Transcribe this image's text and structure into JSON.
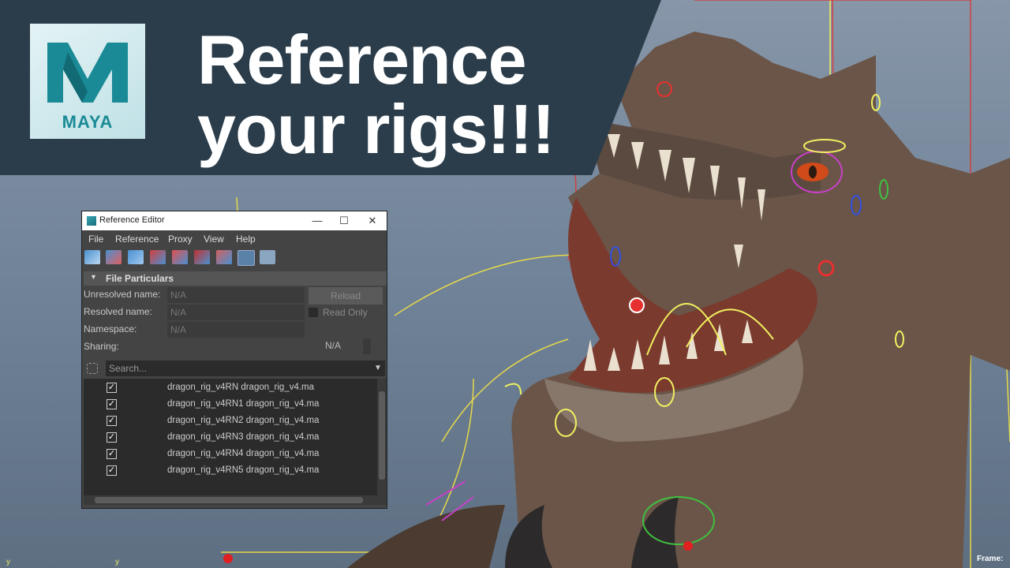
{
  "banner": {
    "logo_word": "MAYA",
    "headline_line1": "Reference",
    "headline_line2": "your rigs!!!",
    "colors": {
      "banner_bg": "#2b3d4a",
      "logo_accent": "#1a8a96"
    }
  },
  "window": {
    "title": "Reference Editor",
    "controls": {
      "minimize": "—",
      "maximize": "☐",
      "close": "✕"
    },
    "menus": [
      "File",
      "Reference",
      "Proxy",
      "View",
      "Help"
    ],
    "toolbar_icons": [
      "load-reference-icon",
      "unload-reference-icon",
      "reload-reference-icon",
      "remove-reference-icon",
      "import-objects-icon",
      "export-icon",
      "duplicate-reference-icon",
      "list-view-icon",
      "table-view-icon"
    ],
    "section_title": "File Particulars",
    "section_arrow": "▼",
    "fields": {
      "unresolved_label": "Unresolved name:",
      "unresolved_value": "N/A",
      "resolved_label": "Resolved name:",
      "resolved_value": "N/A",
      "namespace_label": "Namespace:",
      "namespace_value": "N/A",
      "sharing_label": "Sharing:",
      "sharing_value": "N/A"
    },
    "reload_label": "Reload",
    "readonly_label": "Read Only",
    "search_placeholder": "Search...",
    "search_dropdown_arrow": "▼",
    "references": [
      {
        "checked": "✓",
        "text": "dragon_rig_v4RN dragon_rig_v4.ma"
      },
      {
        "checked": "✓",
        "text": "dragon_rig_v4RN1 dragon_rig_v4.ma"
      },
      {
        "checked": "✓",
        "text": "dragon_rig_v4RN2 dragon_rig_v4.ma"
      },
      {
        "checked": "✓",
        "text": "dragon_rig_v4RN3 dragon_rig_v4.ma"
      },
      {
        "checked": "✓",
        "text": "dragon_rig_v4RN4 dragon_rig_v4.ma"
      },
      {
        "checked": "✓",
        "text": "dragon_rig_v4RN5 dragon_rig_v4.ma"
      }
    ]
  },
  "viewport": {
    "frame_label": "Frame:",
    "axis_y_label": "y"
  }
}
